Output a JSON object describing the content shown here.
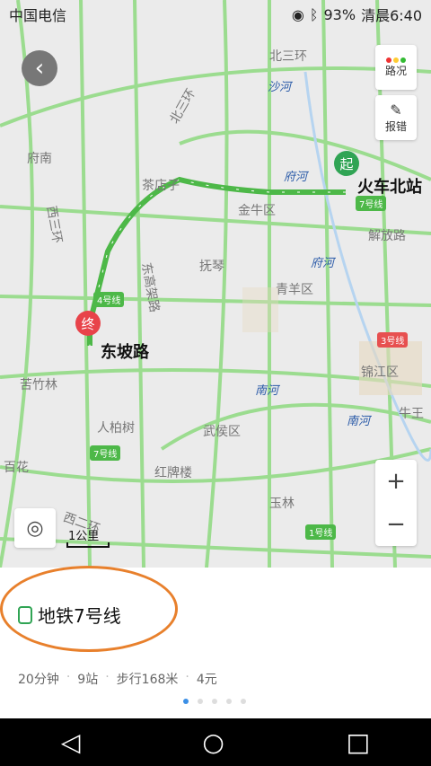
{
  "status_bar": {
    "carrier": "中国电信",
    "battery": "93%",
    "time_label": "清晨6:40"
  },
  "map": {
    "start_marker": "起",
    "end_marker": "终",
    "start_station": "火车北站",
    "end_station": "东坡路",
    "places": [
      "北三环",
      "北三环",
      "沙河",
      "府河",
      "茶店子",
      "金牛区",
      "解放路",
      "抚琴",
      "府河",
      "青羊区",
      "锦江区",
      "南河",
      "南河",
      "苦竹林",
      "武侯区",
      "红牌楼",
      "玉林",
      "人柏树",
      "牛王",
      "百花",
      "西二环",
      "东高架路",
      "西三环",
      "府南"
    ],
    "lines": [
      "7号线",
      "4号线",
      "3号线",
      "7号线",
      "1号线"
    ],
    "traffic_label": "路况",
    "report_label": "报错",
    "scale_label": "1公里"
  },
  "panel": {
    "title": "地铁7号线",
    "duration": "20分钟",
    "stops": "9站",
    "walk": "步行168米",
    "fare": "4元"
  },
  "colors": {
    "route": "#4db848",
    "road": "#8cd680",
    "accent": "#3b8fe6",
    "annotation": "#e8802c"
  }
}
